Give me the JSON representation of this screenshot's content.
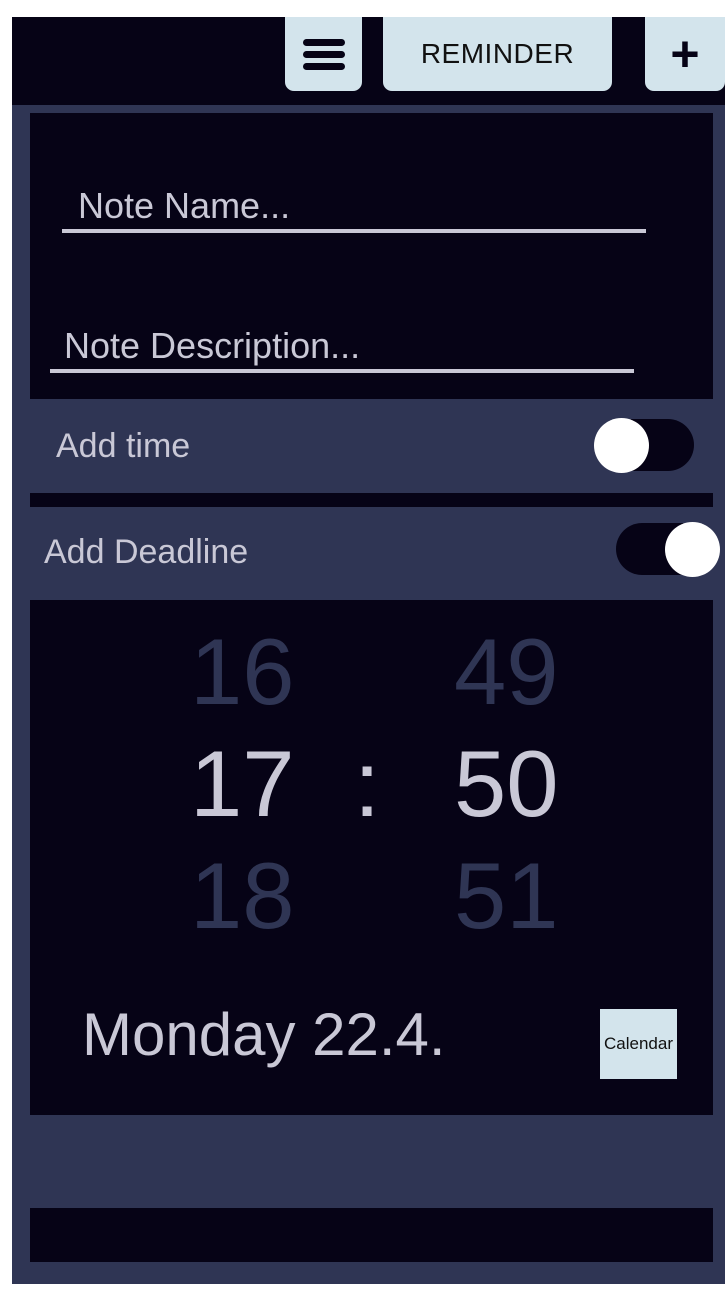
{
  "header": {
    "menu_icon": "hamburger-menu-icon",
    "reminder_label": "REMINDER",
    "add_label": "+"
  },
  "note": {
    "name_placeholder": "Note Name...",
    "description_placeholder": "Note Description..."
  },
  "options": {
    "add_time_label": "Add time",
    "add_time_enabled": false,
    "add_deadline_label": "Add Deadline",
    "add_deadline_enabled": true
  },
  "time_picker": {
    "hour_prev": "16",
    "hour_current": "17",
    "hour_next": "18",
    "separator": ":",
    "minute_prev": "49",
    "minute_current": "50",
    "minute_next": "51"
  },
  "date": {
    "text": "Monday 22.4.",
    "calendar_label": "Calendar"
  },
  "colors": {
    "background": "#2f3554",
    "panel": "#060316",
    "button": "#d3e4ec",
    "text": "#c9c8d6"
  }
}
